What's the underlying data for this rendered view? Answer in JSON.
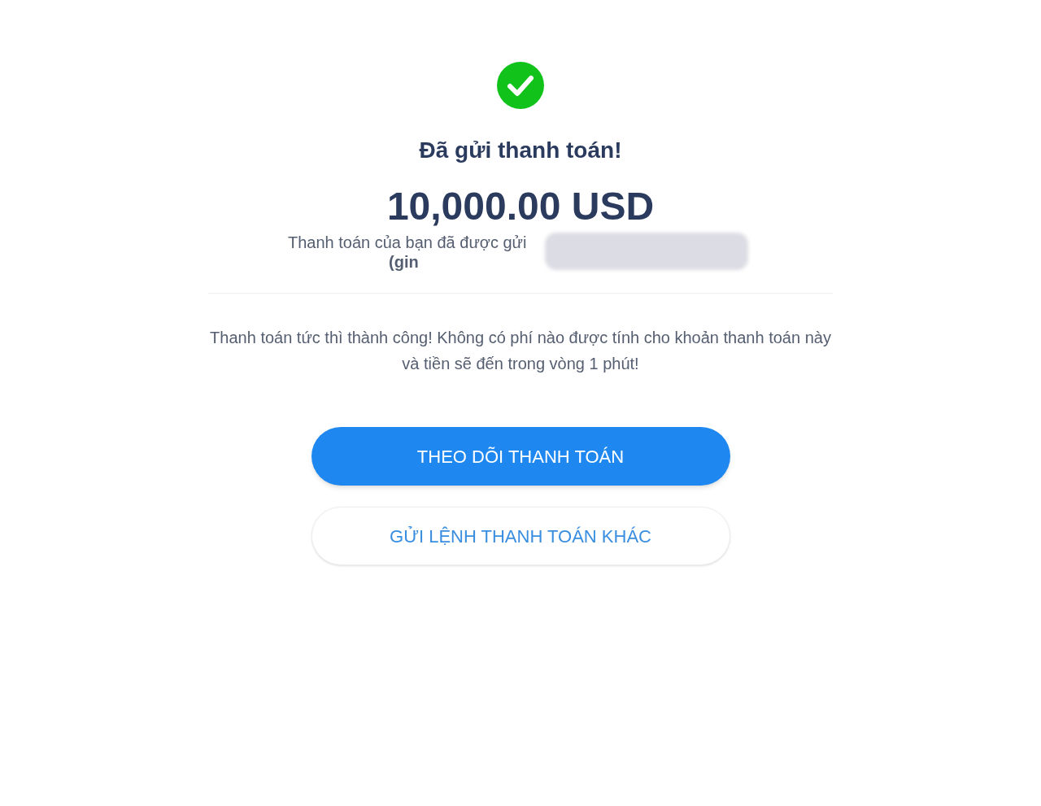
{
  "title": "Đã gửi thanh toán!",
  "amount": "10,000.00 USD",
  "recipient_lines": [
    "Thanh toán của bạn đã được gửi",
    "(gin"
  ],
  "recipient_redacted": true,
  "message": "Thanh toán tức thì thành công! Không có phí nào được tính cho khoản thanh toán này và tiền sẽ đến trong vòng 1 phút!",
  "buttons": [
    {
      "label": "THEO DÕI THANH TOÁN",
      "kind": "primary"
    },
    {
      "label": "GỬI LỆNH THANH TOÁN KHÁC",
      "kind": "secondary"
    }
  ]
}
